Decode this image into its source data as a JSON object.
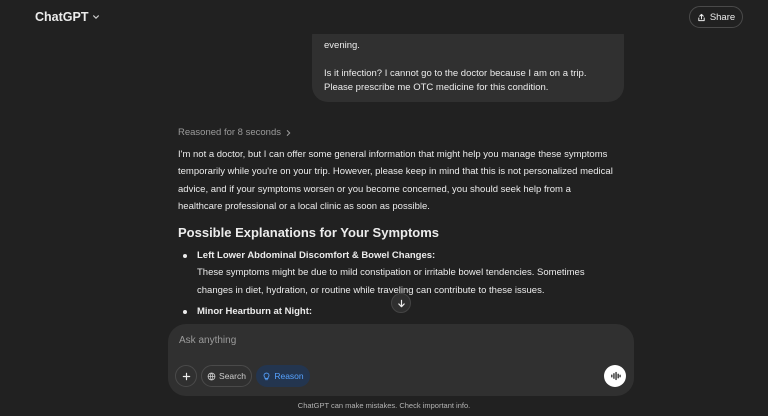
{
  "header": {
    "app_title": "ChatGPT",
    "share_label": "Share"
  },
  "user_message": {
    "line1": "evening.",
    "line2": "Is it infection? I cannot go to the doctor because I am on a trip.",
    "line3": "Please prescribe me OTC medicine for this condition."
  },
  "assistant": {
    "reasoned_label": "Reasoned for 8 seconds",
    "intro_lines": [
      "I'm not a doctor, but I can offer some general information that might help you manage these symptoms",
      "temporarily while you're on your trip. However, please keep in mind that this is not personalized medical",
      "advice, and if your symptoms worsen or you become concerned, you should seek help from a",
      "healthcare professional or a local clinic as soon as possible."
    ],
    "section_heading": "Possible Explanations for Your Symptoms",
    "items": [
      {
        "title": "Left Lower Abdominal Discomfort & Bowel Changes:",
        "body_lines": [
          "These symptoms might be due to mild constipation or irritable bowel tendencies. Sometimes",
          "changes in diet, hydration, or routine while traveling can contribute to these issues."
        ]
      },
      {
        "title": "Minor Heartburn at Night:"
      }
    ]
  },
  "composer": {
    "placeholder": "Ask anything",
    "search_label": "Search",
    "reason_label": "Reason"
  },
  "footer": {
    "disclaimer": "ChatGPT can make mistakes. Check important info."
  },
  "colors": {
    "background": "#212121",
    "bubble": "#303030",
    "reason_accent": "#56a2ff"
  },
  "icons": [
    "chevron-down-icon",
    "share-icon",
    "chevron-right-icon",
    "arrow-down-icon",
    "plus-icon",
    "globe-icon",
    "lightbulb-icon",
    "voice-waveform-icon"
  ]
}
